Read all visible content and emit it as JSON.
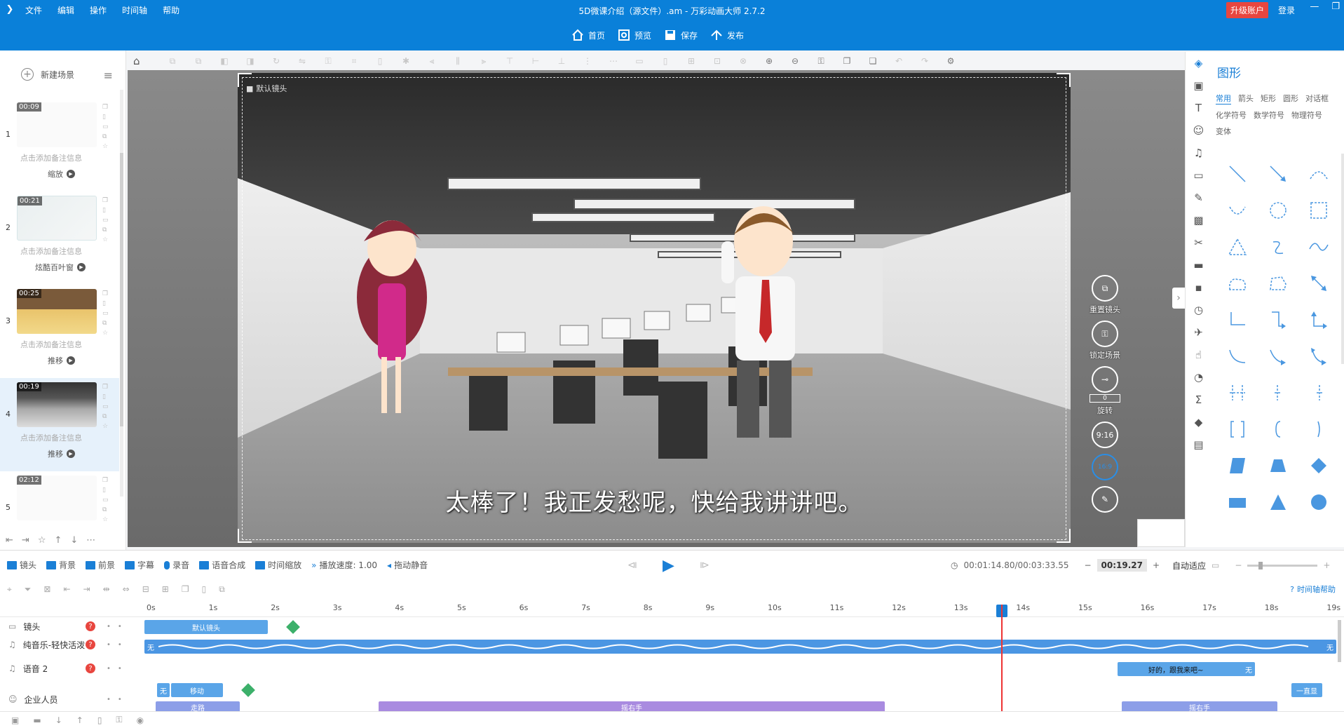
{
  "menu": {
    "items": [
      "文件",
      "编辑",
      "操作",
      "时间轴",
      "帮助"
    ]
  },
  "window_title": "5D微课介绍（源文件）.am - 万彩动画大师 2.7.2",
  "account": {
    "upgrade": "升级账户",
    "login": "登录"
  },
  "actions": {
    "home": "首页",
    "preview": "预览",
    "save": "保存",
    "publish": "发布"
  },
  "scene_panel": {
    "new_scene": "新建场景",
    "scenes": [
      {
        "index": "1",
        "duration": "00:09",
        "note": "点击添加备注信息",
        "transition": "缩放"
      },
      {
        "index": "2",
        "duration": "00:21",
        "note": "点击添加备注信息",
        "transition": "炫酷百叶窗"
      },
      {
        "index": "3",
        "duration": "00:25",
        "note": "点击添加备注信息",
        "transition": "推移"
      },
      {
        "index": "4",
        "duration": "00:19",
        "note": "点击添加备注信息",
        "transition": "推移"
      },
      {
        "index": "5",
        "duration": "02:12",
        "note": "",
        "transition": ""
      }
    ]
  },
  "canvas": {
    "camera_label": "默认镜头",
    "subtitle": "太棒了！我正发愁呢，快给我讲讲吧。",
    "tools": {
      "reset_camera": "重置镜头",
      "lock_scene": "锁定场景",
      "rotate": "旋转",
      "rotate_value": "0",
      "ratio": "9:16",
      "ratio2": "16:9"
    }
  },
  "right_panel": {
    "title": "图形",
    "tabs": [
      "常用",
      "箭头",
      "矩形",
      "圆形",
      "对话框",
      "化学符号",
      "数学符号",
      "物理符号",
      "变体"
    ],
    "active_tab": "常用"
  },
  "timeline": {
    "buttons": {
      "camera": "镜头",
      "background": "背景",
      "foreground": "前景",
      "caption": "字幕",
      "record": "录音",
      "tts": "语音合成",
      "time_zoom": "时间缩放",
      "speed": "播放速度: 1.00",
      "mute": "拖动静音"
    },
    "time_display": "00:01:14.80/00:03:33.55",
    "current_time": "00:19.27",
    "auto_fit": "自动适应",
    "help": "时间轴帮助",
    "ruler": [
      "0s",
      "1s",
      "2s",
      "3s",
      "4s",
      "5s",
      "6s",
      "7s",
      "8s",
      "9s",
      "10s",
      "11s",
      "12s",
      "13s",
      "14s",
      "15s",
      "16s",
      "17s",
      "18s",
      "19s"
    ],
    "tracks": [
      {
        "name": "镜头",
        "clips": [
          {
            "label": "默认镜头"
          }
        ]
      },
      {
        "name": "纯音乐-轻快活泼",
        "clips": [
          {
            "label": "无"
          },
          {
            "label": "无"
          }
        ]
      },
      {
        "name": "语音 2",
        "clips": [
          {
            "label": "好的，跟我来吧~"
          },
          {
            "label": "无"
          }
        ]
      },
      {
        "name": "企业人员",
        "clips": [
          {
            "label": "无"
          },
          {
            "label": "移动"
          },
          {
            "label": "走路"
          },
          {
            "label": "摇右手"
          },
          {
            "label": "摇右手"
          },
          {
            "label": "一直显"
          }
        ]
      }
    ],
    "playhead_seconds": 13.7
  },
  "colors": {
    "header": "#0a80d9",
    "accent": "#1a7fd6",
    "camera_clip": "#5aa5e8",
    "action_clip": "#a98be0",
    "music_clip": "#4b96e3"
  }
}
